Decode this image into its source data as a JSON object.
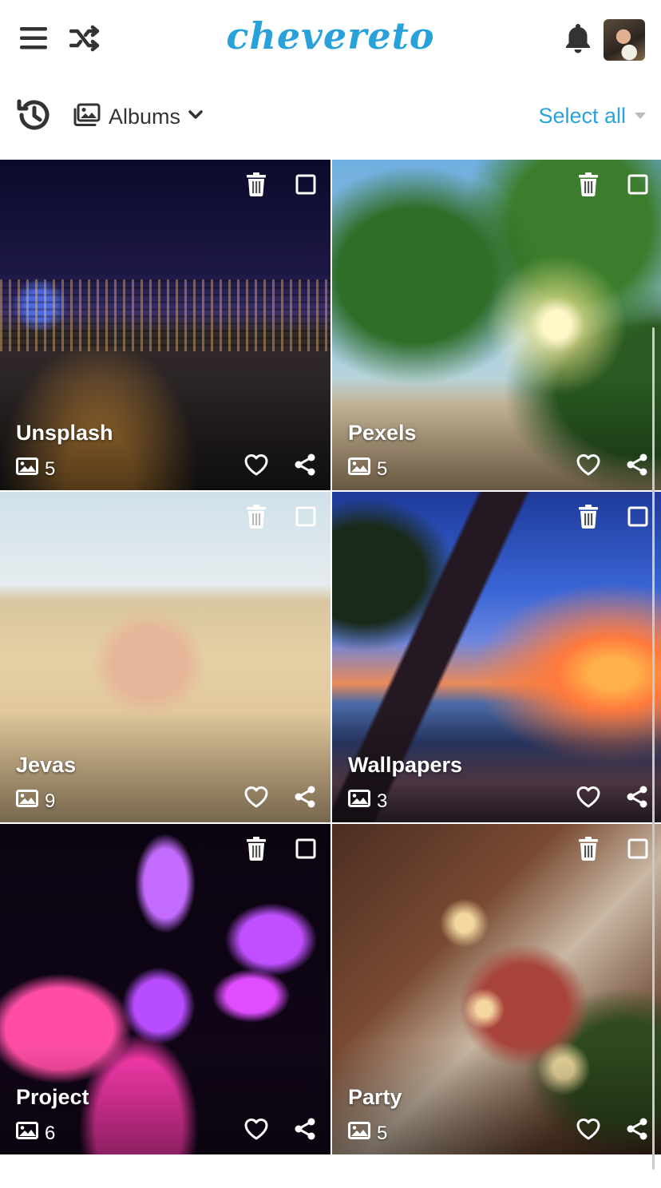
{
  "app": {
    "logo_text": "chevereto",
    "brand_color": "#29a2dc"
  },
  "header": {
    "icons": [
      "menu-icon",
      "shuffle-icon",
      "bell-icon"
    ],
    "avatar": "user-avatar"
  },
  "toolbar": {
    "history_icon": "history-icon",
    "albums_label": "Albums",
    "albums_icon": "images-icon",
    "select_all_label": "Select all"
  },
  "albums": [
    {
      "title": "Unsplash",
      "count": "5"
    },
    {
      "title": "Pexels",
      "count": "5"
    },
    {
      "title": "Jevas",
      "count": "9"
    },
    {
      "title": "Wallpapers",
      "count": "3"
    },
    {
      "title": "Project",
      "count": "6"
    },
    {
      "title": "Party",
      "count": "5"
    }
  ]
}
